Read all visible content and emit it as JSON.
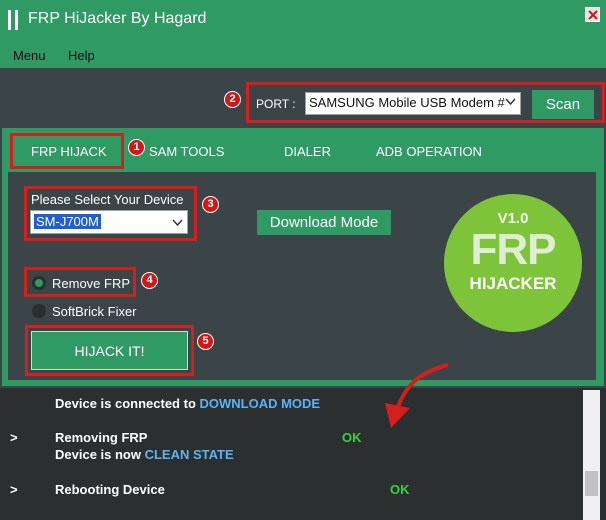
{
  "window": {
    "title": "FRP HiJacker By Hagard"
  },
  "menu": {
    "items": [
      {
        "label": "Menu"
      },
      {
        "label": "Help"
      }
    ]
  },
  "port": {
    "label": "PORT :",
    "selected": "SAMSUNG Mobile USB Modem #",
    "scan_label": "Scan"
  },
  "tabs": [
    {
      "label": "FRP HIJACK",
      "active": true
    },
    {
      "label": "SAM TOOLS"
    },
    {
      "label": "DIALER"
    },
    {
      "label": "ADB OPERATION"
    }
  ],
  "device": {
    "label": "Please Select Your Device",
    "selected": "SM-J700M",
    "download_mode_label": "Download Mode"
  },
  "options": [
    {
      "label": "Remove FRP",
      "selected": true
    },
    {
      "label": "SoftBrick Fixer",
      "selected": false
    }
  ],
  "hijack_label": "HIJACK IT!",
  "logo": {
    "version": "V1.0",
    "line1": "FRP",
    "line2": "HIJACKER"
  },
  "badges": [
    "1",
    "2",
    "3",
    "4",
    "5"
  ],
  "log": {
    "line1_prefix": "Device is connected to ",
    "line1_highlight": "DOWNLOAD MODE",
    "line2_marker": ">",
    "line2_text": "Removing FRP",
    "line2_status": "OK",
    "line3_prefix": "Device is now ",
    "line3_highlight": "CLEAN STATE",
    "line4_marker": ">",
    "line4_text": "Rebooting Device",
    "line4_status": "OK"
  },
  "colors": {
    "accent": "#2f9a63",
    "background": "#3b4447",
    "annotation": "#d41f1f",
    "ok": "#36d23e",
    "highlight": "#5fb2f2"
  }
}
